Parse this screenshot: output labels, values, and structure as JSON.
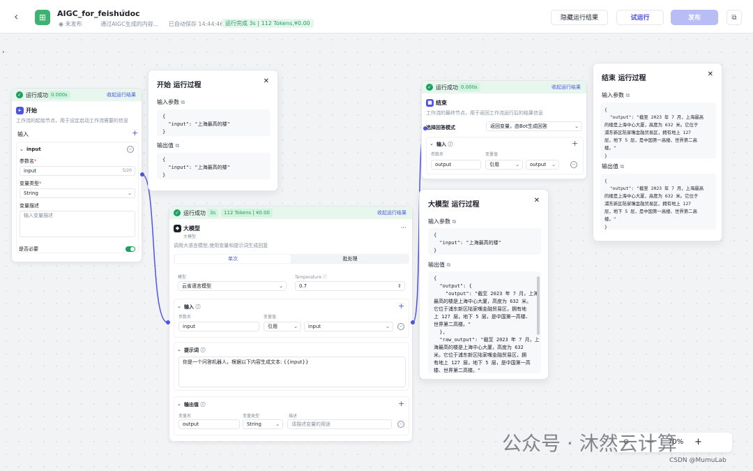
{
  "header": {
    "back_icon": "‹",
    "app_title": "AIGC_for_feishudoc",
    "status_unpublished": "未发布",
    "description": "通过AIGC生成的内容...",
    "autosave": "已自动保存 14:44:46",
    "run_status": "运行完成 3s | 112 Tokens,¥0.00",
    "hide_results": "隐藏运行结果",
    "test_run": "试运行",
    "publish": "发布"
  },
  "start_node": {
    "status": "运行成功",
    "time": "0.000s",
    "collapse": "收起运行结果",
    "title": "开始",
    "desc": "工作流的起始节点，用于设定启动工作流需要的信息",
    "input_label": "输入",
    "var_name": "input",
    "param_name_label": "参数名",
    "param_name_value": "input",
    "char_count": "5/20",
    "var_type_label": "变量类型",
    "var_type_value": "String",
    "var_desc_label": "变量描述",
    "var_desc_placeholder": "输入变量描述",
    "required_label": "是否必要"
  },
  "start_panel": {
    "title": "开始 运行过程",
    "input_params": "输入参数",
    "input_code": "{\n  \"input\": \"上海最高的楼\"\n}",
    "output_label": "输出值",
    "output_code": "{\n  \"input\": \"上海最高的楼\"\n}"
  },
  "llm_node": {
    "status": "运行成功",
    "time": "3s",
    "tokens": "112 Tokens | ¥0.00",
    "collapse": "收起运行结果",
    "title": "大模型",
    "subtitle": "大模型",
    "more": "···",
    "desc": "调用大语言模型,使用变量和提示词生成回复",
    "tab_single": "单次",
    "tab_batch": "批处理",
    "model_label": "模型",
    "model_value": "云雀语言模型",
    "temp_label": "Temperature",
    "temp_value": "0.7",
    "input_label": "输入",
    "param_name_label": "参数名",
    "var_value_label": "变量值",
    "param_name": "input",
    "ref": "引用",
    "ref_var": "input",
    "prompt_label": "提示词",
    "prompt_text": "你是一个问答机器人，根据以下内容生成文本: {{input}}",
    "output_label": "输出值",
    "out_name_label": "变量名",
    "out_type_label": "变量类型",
    "out_desc_label": "描述",
    "out_name": "output",
    "out_type": "String",
    "out_desc_placeholder": "请描述变量的用途"
  },
  "end_node": {
    "status": "运行成功",
    "time": "0.000s",
    "collapse": "收起运行结果",
    "title": "结束",
    "desc": "工作流的最终节点，用于返回工作流运行后的结果信息",
    "answer_mode_label": "选择回答模式",
    "answer_mode_value": "返回变量，由Bot生成回答",
    "input_label": "输入",
    "param_name_label": "参数名",
    "var_value_label": "变量值",
    "param_name": "output",
    "ref": "引用",
    "ref_var": "output"
  },
  "llm_panel": {
    "title": "大模型 运行过程",
    "input_params": "输入参数",
    "input_code": "{\n  \"input\": \"上海最高的楼\"\n}",
    "output_label": "输出值",
    "output_code": "{\n  \"output\": {\n    \"output\": \"截至 2023 年 7 月，上海\n最高的楼是上海中心大厦，高度为 632 米。\n它位于浦东新区陆家嘴金融贸易区，拥有地\n上 127 层，地下 5 层，是中国第一高楼、\n世界第二高楼。\"\n  },\n  \"raw_output\": \"截至 2023 年 7 月，上\n海最高的楼是上海中心大厦，高度为 632\n米。它位于浦东新区陆家嘴金融贸易区，拥\n有地上 127 层，地下 5 层，是中国第一高\n楼、世界第二高楼。\"\n}"
  },
  "end_panel": {
    "title": "结束 运行过程",
    "input_params": "输入参数",
    "input_code": "{\n  \"output\": \"截至 2023 年 7 月，上海最高\n的楼是上海中心大厦，高度为 632 米。它位于\n浦东新区陆家嘴金融贸易区，拥有地上 127\n层，地下 5 层，是中国第一高楼、世界第二高\n楼。\"\n}",
    "output_label": "输出值",
    "output_code": "{\n  \"output\": \"截至 2023 年 7 月，上海最高\n的楼是上海中心大厦，高度为 632 米。它位于\n浦东新区陆家嘴金融贸易区，拥有地上 127\n层，地下 5 层，是中国第一高楼、世界第二高\n楼。\"\n}"
  },
  "zoom": {
    "level": "70%",
    "minus": "—",
    "plus": "+"
  },
  "watermark": "公众号 · 沐然云计算",
  "csdn": "CSDN @MumuLab",
  "colors": {
    "accent": "#4d53e8",
    "success": "#1aa160"
  }
}
